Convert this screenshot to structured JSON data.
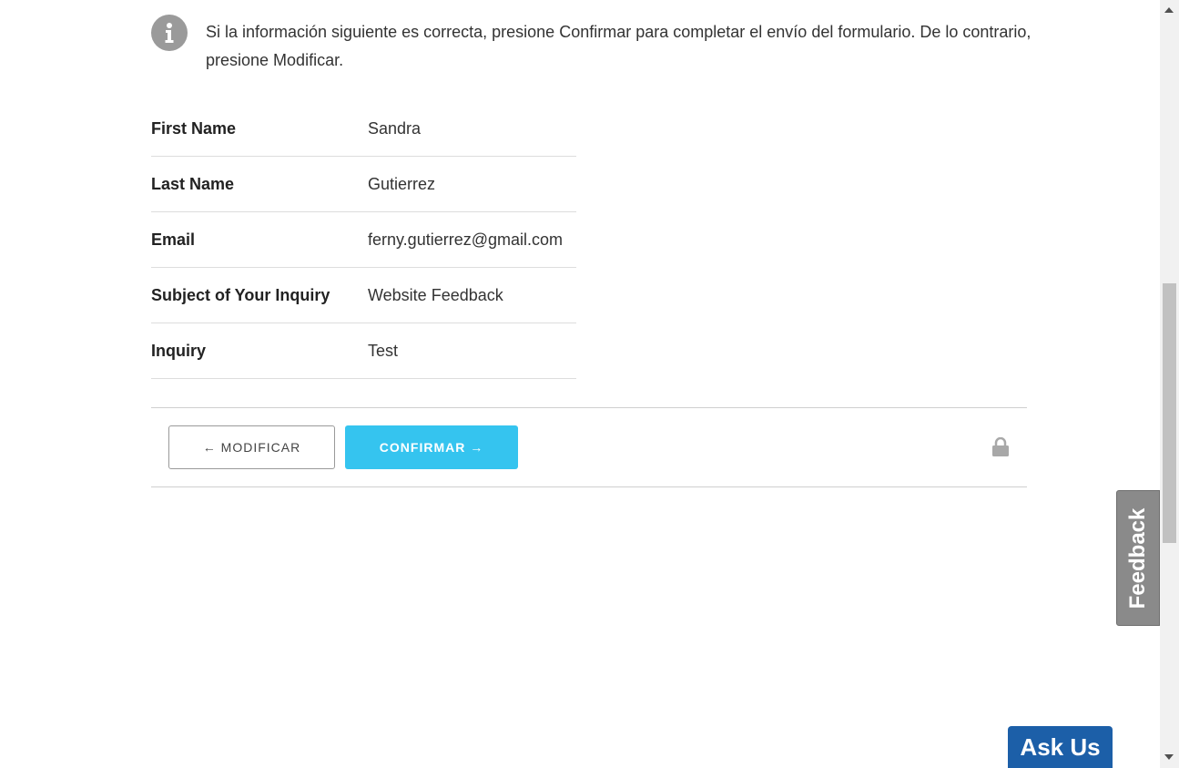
{
  "notice": {
    "icon": "info-icon",
    "text": "Si la información siguiente es correcta, presione Confirmar para completar el envío del formulario. De lo contrario, presione Modificar."
  },
  "summary": [
    {
      "label": "First Name",
      "value": "Sandra"
    },
    {
      "label": "Last Name",
      "value": "Gutierrez"
    },
    {
      "label": "Email",
      "value": "ferny.gutierrez@gmail.com"
    },
    {
      "label": "Subject of Your Inquiry",
      "value": "Website Feedback"
    },
    {
      "label": "Inquiry",
      "value": "Test"
    }
  ],
  "actions": {
    "modify_label": "← MODIFICAR",
    "confirm_label": "CONFIRMAR →",
    "lock_icon": "lock-icon"
  },
  "feedback_tab": {
    "label": "Feedback"
  },
  "ask_us": {
    "label": "Ask Us"
  },
  "colors": {
    "confirm_button": "#35c4ef",
    "ask_us_button": "#1c5fa8",
    "feedback_tab": "#8a8a8a"
  }
}
